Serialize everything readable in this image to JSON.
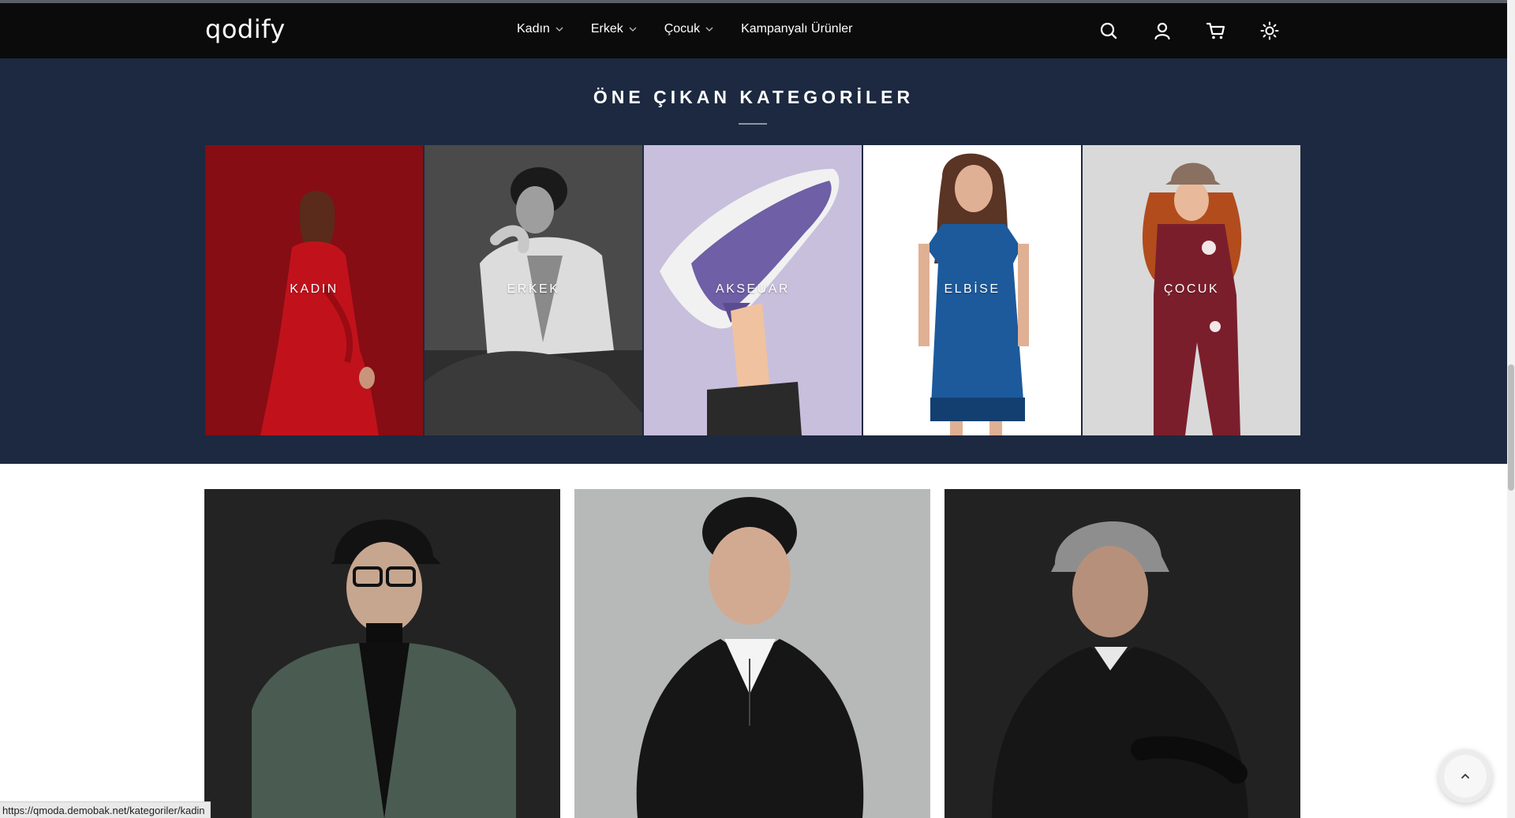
{
  "brand": {
    "logo_text": "qodify"
  },
  "nav": {
    "items": [
      {
        "label": "Kadın",
        "has_dropdown": true
      },
      {
        "label": "Erkek",
        "has_dropdown": true
      },
      {
        "label": "Çocuk",
        "has_dropdown": true
      },
      {
        "label": "Kampanyalı Ürünler",
        "has_dropdown": false
      }
    ]
  },
  "header_icons": [
    "search-icon",
    "user-icon",
    "cart-icon",
    "theme-toggle-icon"
  ],
  "featured": {
    "title": "ÖNE ÇIKAN KATEGORİLER",
    "categories": [
      {
        "label": "KADIN",
        "active": true
      },
      {
        "label": "ERKEK",
        "active": false
      },
      {
        "label": "AKSEUAR",
        "active": false
      },
      {
        "label": "ELBİSE",
        "active": false
      },
      {
        "label": "ÇOCUK",
        "active": false
      }
    ]
  },
  "colors": {
    "header_bg": "#0b0b0c",
    "band_bg": "#1c2940",
    "kadin_bg": "#8c0e14",
    "akseuar_bg": "#c7bfdc",
    "cocuk_bg": "#d9d9d9"
  },
  "status_bar": {
    "url": "https://qmoda.demobak.net/kategoriler/kadin"
  }
}
